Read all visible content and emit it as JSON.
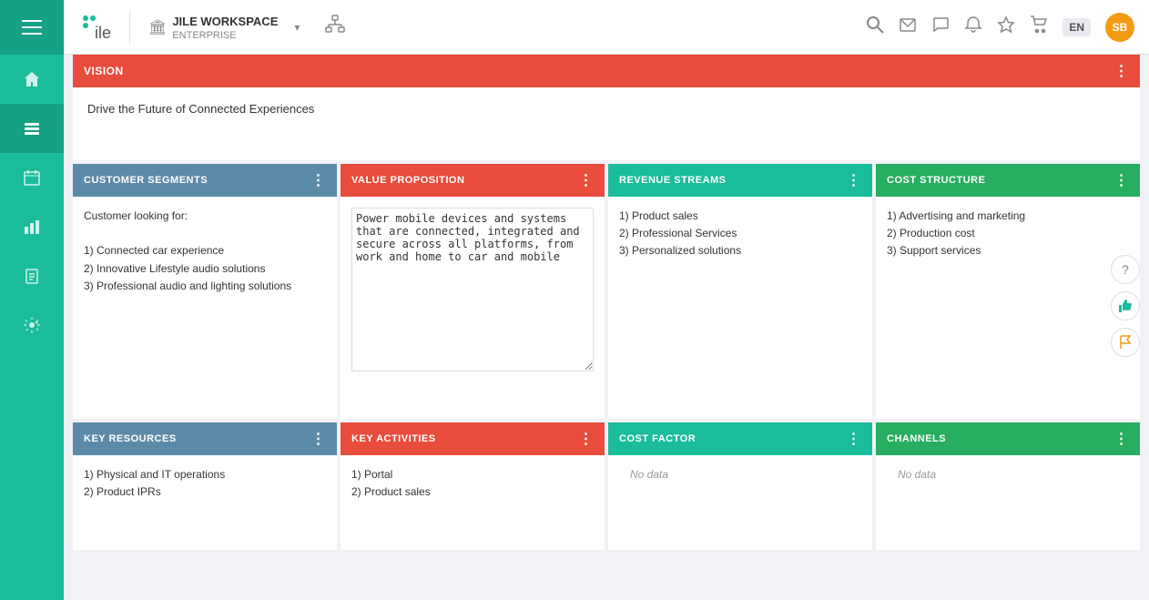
{
  "sidebar": {
    "hamburger_icon": "☰",
    "items": [
      {
        "name": "home",
        "icon": "⌂",
        "active": false
      },
      {
        "name": "layers",
        "icon": "◧",
        "active": true
      },
      {
        "name": "calendar",
        "icon": "▦",
        "active": false
      },
      {
        "name": "chart",
        "icon": "▤",
        "active": false
      },
      {
        "name": "clipboard",
        "icon": "▣",
        "active": false
      },
      {
        "name": "settings",
        "icon": "⚙",
        "active": false
      }
    ]
  },
  "topbar": {
    "workspace_icon": "🏛",
    "workspace_name": "JILE WORKSPACE",
    "workspace_type": "ENTERPRISE",
    "chevron": "▾",
    "org_icon": "⚭",
    "lang": "EN",
    "user_initials": "SB"
  },
  "vision": {
    "label": "VISION",
    "content": "Drive the Future of Connected Experiences",
    "menu_icon": "⋮"
  },
  "grid": {
    "row1": [
      {
        "header": "CUSTOMER SEGMENTS",
        "color": "blue-gray",
        "content": "Customer looking for:\n\n1) Connected car experience\n2) Innovative Lifestyle audio solutions\n3) Professional audio and lighting solutions",
        "menu_icon": "⋮"
      },
      {
        "header": "VALUE PROPOSITION",
        "color": "red",
        "content": "Power mobile devices and systems that are connected, integrated and secure across all platforms, from work and home to car and mobile",
        "menu_icon": "⋮",
        "has_textarea": true
      },
      {
        "header": "REVENUE STREAMS",
        "color": "teal",
        "content": "1) Product sales\n2) Professional Services\n3) Personalized solutions",
        "menu_icon": "⋮"
      },
      {
        "header": "COST STRUCTURE",
        "color": "green",
        "content": "1) Advertising and marketing\n2) Production cost\n3) Support services",
        "menu_icon": "⋮"
      }
    ],
    "row2": [
      {
        "header": "KEY RESOURCES",
        "color": "blue-gray",
        "content": "1) Physical and IT operations\n2) Product IPRs",
        "menu_icon": "⋮"
      },
      {
        "header": "KEY ACTIVITIES",
        "color": "red",
        "content": "1) Portal\n2) Product sales",
        "menu_icon": "⋮"
      },
      {
        "header": "COST FACTOR",
        "color": "teal",
        "content": "No data",
        "menu_icon": "⋮"
      },
      {
        "header": "CHANNELS",
        "color": "green",
        "content": "No data",
        "menu_icon": "⋮"
      }
    ]
  },
  "right_panel": {
    "help_icon": "?",
    "like_icon": "👍",
    "flag_icon": "🚩"
  }
}
